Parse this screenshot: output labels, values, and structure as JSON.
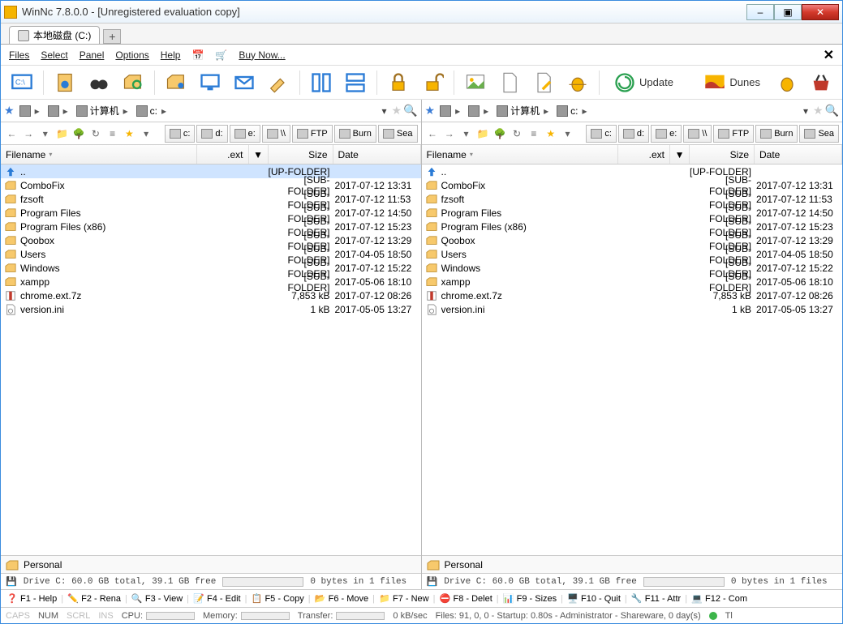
{
  "window": {
    "title": "WinNc 7.8.0.0 - [Unregistered evaluation copy]",
    "min": "–",
    "max": "▣",
    "close": "✕"
  },
  "tab": {
    "label": "本地磁盘 (C:)",
    "add": "+"
  },
  "menu": {
    "files": "Files",
    "select": "Select",
    "panel": "Panel",
    "options": "Options",
    "help": "Help",
    "buynow": "Buy Now...",
    "close": "✕"
  },
  "toolbar": {
    "update": "Update",
    "dunes": "Dunes"
  },
  "path": {
    "crumbs": [
      {
        "label": ""
      },
      {
        "label": ""
      },
      {
        "label": "计算机"
      },
      {
        "label": "c:"
      }
    ],
    "dd": "▾",
    "sep": "▸"
  },
  "drivebar": {
    "nav": [
      "←",
      "→",
      "▾"
    ],
    "items": [
      {
        "label": "c:"
      },
      {
        "label": "d:"
      },
      {
        "label": "e:"
      },
      {
        "label": "\\\\"
      },
      {
        "label": "FTP"
      },
      {
        "label": "Burn"
      },
      {
        "label": "Sea"
      }
    ]
  },
  "columns": {
    "filename": "Filename",
    "ext": ".ext",
    "dd": "▼",
    "size": "Size",
    "date": "Date"
  },
  "upfolder": {
    "name": "..",
    "size": "[UP-FOLDER]"
  },
  "files": [
    {
      "icon": "fold",
      "name": "ComboFix",
      "size": "[SUB-FOLDER]",
      "date": "2017-07-12 13:31"
    },
    {
      "icon": "fold",
      "name": "fzsoft",
      "size": "[SUB-FOLDER]",
      "date": "2017-07-12 11:53"
    },
    {
      "icon": "fold",
      "name": "Program Files",
      "size": "[SUB-FOLDER]",
      "date": "2017-07-12 14:50"
    },
    {
      "icon": "fold",
      "name": "Program Files (x86)",
      "size": "[SUB-FOLDER]",
      "date": "2017-07-12 15:23"
    },
    {
      "icon": "fold",
      "name": "Qoobox",
      "size": "[SUB-FOLDER]",
      "date": "2017-07-12 13:29"
    },
    {
      "icon": "fold",
      "name": "Users",
      "size": "[SUB-FOLDER]",
      "date": "2017-04-05 18:50"
    },
    {
      "icon": "fold",
      "name": "Windows",
      "size": "[SUB-FOLDER]",
      "date": "2017-07-12 15:22"
    },
    {
      "icon": "fold",
      "name": "xampp",
      "size": "[SUB-FOLDER]",
      "date": "2017-05-06 18:10"
    },
    {
      "icon": "arch",
      "name": "chrome.ext.7z",
      "size": "7,853 kB",
      "date": "2017-07-12 08:26"
    },
    {
      "icon": "ini",
      "name": "version.ini",
      "size": "1 kB",
      "date": "2017-05-05 13:27"
    }
  ],
  "personal": {
    "label": "Personal"
  },
  "driveinfo": {
    "text": "Drive C: 60.0 GB total, 39.1 GB free",
    "sel": "0 bytes in 1 files"
  },
  "fkeys": [
    {
      "k": "F1 - Help"
    },
    {
      "k": "F2 - Rena"
    },
    {
      "k": "F3 - View"
    },
    {
      "k": "F4 - Edit"
    },
    {
      "k": "F5 - Copy"
    },
    {
      "k": "F6 - Move"
    },
    {
      "k": "F7 - New"
    },
    {
      "k": "F8 - Delet"
    },
    {
      "k": "F9 - Sizes"
    },
    {
      "k": "F10 - Quit"
    },
    {
      "k": "F11 - Attr"
    },
    {
      "k": "F12 - Com"
    }
  ],
  "status": {
    "caps": "CAPS",
    "num": "NUM",
    "scrl": "SCRL",
    "ins": "INS",
    "cpu": "CPU:",
    "mem": "Memory:",
    "transfer": "Transfer:",
    "rate": "0 kB/sec",
    "right": "Files: 91, 0, 0 - Startup: 0.80s - Administrator - Shareware, 0 day(s)",
    "tail": "Tl"
  }
}
